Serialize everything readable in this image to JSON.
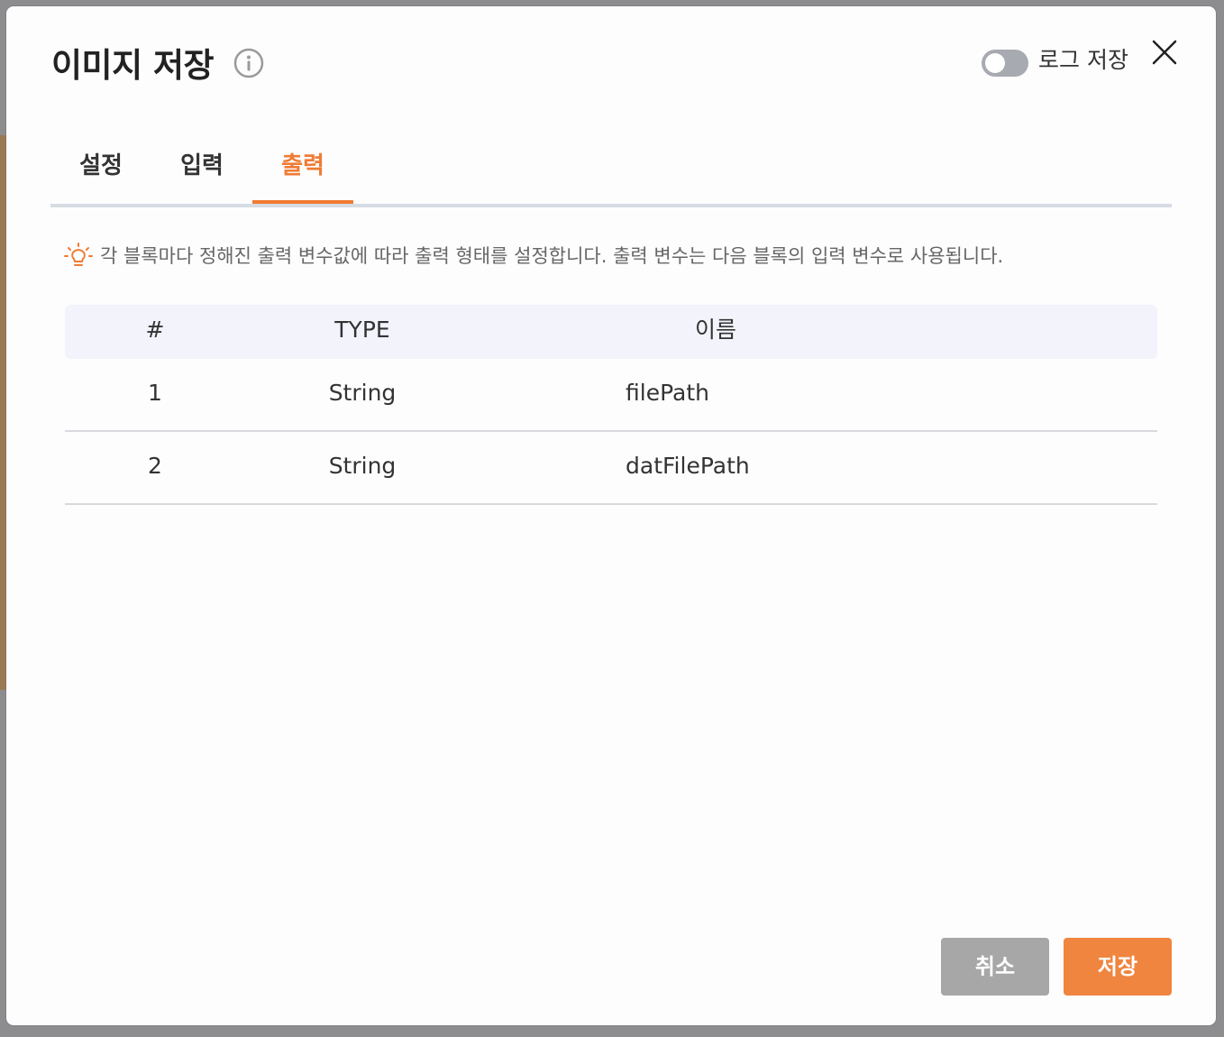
{
  "dialog": {
    "title": "이미지 저장",
    "info_icon": "info-circle-icon",
    "close_icon": "close-icon",
    "log_toggle": {
      "label": "로그 저장",
      "enabled": false
    }
  },
  "tabs": [
    {
      "label": "설정",
      "active": false
    },
    {
      "label": "입력",
      "active": false
    },
    {
      "label": "출력",
      "active": true
    }
  ],
  "hint": {
    "icon": "lightbulb-icon",
    "text": "각 블록마다 정해진 출력 변수값에 따라 출력 형태를 설정합니다. 출력 변수는 다음 블록의 입력 변수로 사용됩니다."
  },
  "table": {
    "headers": [
      "#",
      "TYPE",
      "이름"
    ],
    "rows": [
      {
        "index": "1",
        "type": "String",
        "name": "filePath"
      },
      {
        "index": "2",
        "type": "String",
        "name": "datFilePath"
      }
    ]
  },
  "footer": {
    "cancel_label": "취소",
    "save_label": "저장"
  },
  "colors": {
    "accent": "#f07b34",
    "save_button": "#f0853f",
    "cancel_button": "#a7a7a7",
    "table_header_bg": "#f2f3fb"
  }
}
